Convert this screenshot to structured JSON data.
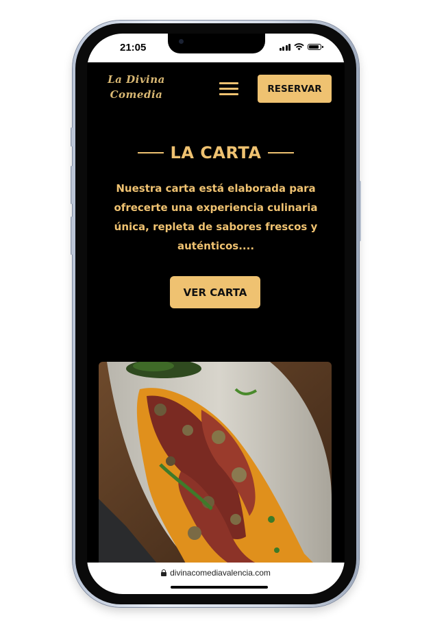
{
  "status_bar": {
    "time": "21:05"
  },
  "header": {
    "logo_line1": "La Divina",
    "logo_line2": "Comedia",
    "menu_icon": "hamburger-icon",
    "reserve_label": "RESERVAR"
  },
  "carta": {
    "title": "LA CARTA",
    "description": "Nuestra carta está elaborada para ofrecerte una experiencia culinaria única, repleta de sabores frescos y auténticos....",
    "button_label": "VER CARTA"
  },
  "photo": {
    "icon": "dish-photo"
  },
  "browser": {
    "url": "divinacomediavalencia.com",
    "lock_icon": "lock-icon"
  },
  "colors": {
    "accent": "#efc271",
    "background": "#000000",
    "logo": "#d9b873"
  }
}
